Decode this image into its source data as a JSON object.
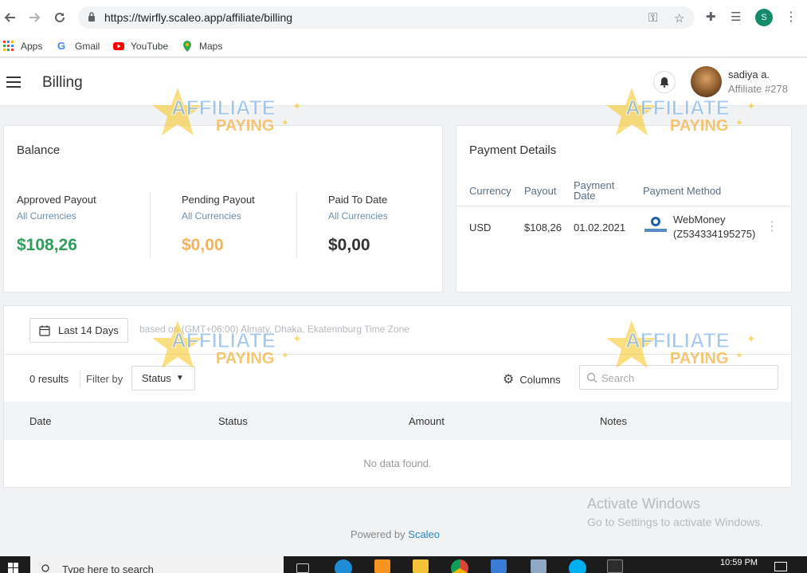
{
  "browser": {
    "url": "https://twirfly.scaleo.app/affiliate/billing",
    "profile_initial": "S",
    "bookmarks": [
      {
        "label": "Apps"
      },
      {
        "label": "Gmail"
      },
      {
        "label": "YouTube"
      },
      {
        "label": "Maps"
      }
    ]
  },
  "header": {
    "title": "Billing",
    "user_name": "sadiya a.",
    "user_sub": "Affiliate #278"
  },
  "balance": {
    "title": "Balance",
    "items": [
      {
        "label": "Approved Payout",
        "sub": "All Currencies",
        "amount": "$108,26",
        "color": "#2e9e5b"
      },
      {
        "label": "Pending Payout",
        "sub": "All Currencies",
        "amount": "$0,00",
        "color": "#f3b35c"
      },
      {
        "label": "Paid To Date",
        "sub": "All Currencies",
        "amount": "$0,00",
        "color": "#333333"
      }
    ]
  },
  "payment_details": {
    "title": "Payment Details",
    "headers": [
      "Currency",
      "Payout",
      "Payment Date",
      "Payment Method"
    ],
    "row": {
      "currency": "USD",
      "payout": "$108,26",
      "date": "01.02.2021",
      "method_name": "WebMoney",
      "method_id": "(Z534334195275)",
      "method_icon": "webmoney-logo"
    }
  },
  "filters": {
    "date_range": "Last 14 Days",
    "tz_note": "based on (GMT+06:00) Almaty, Dhaka, Ekaterinburg Time Zone",
    "results": "0 results",
    "filter_by": "Filter by",
    "status": "Status",
    "columns": "Columns",
    "search_placeholder": "Search"
  },
  "table": {
    "headers": [
      "Date",
      "Status",
      "Amount",
      "Notes"
    ],
    "empty": "No data found."
  },
  "footer": {
    "powered": "Powered by",
    "brand": "Scaleo"
  },
  "windows": {
    "activate_title": "Activate Windows",
    "activate_sub": "Go to Settings to activate Windows.",
    "search_text": "Type here to search",
    "time": "10:59 PM"
  },
  "watermark": {
    "line1": "AFFILIATE",
    "line2": "PAYING"
  }
}
